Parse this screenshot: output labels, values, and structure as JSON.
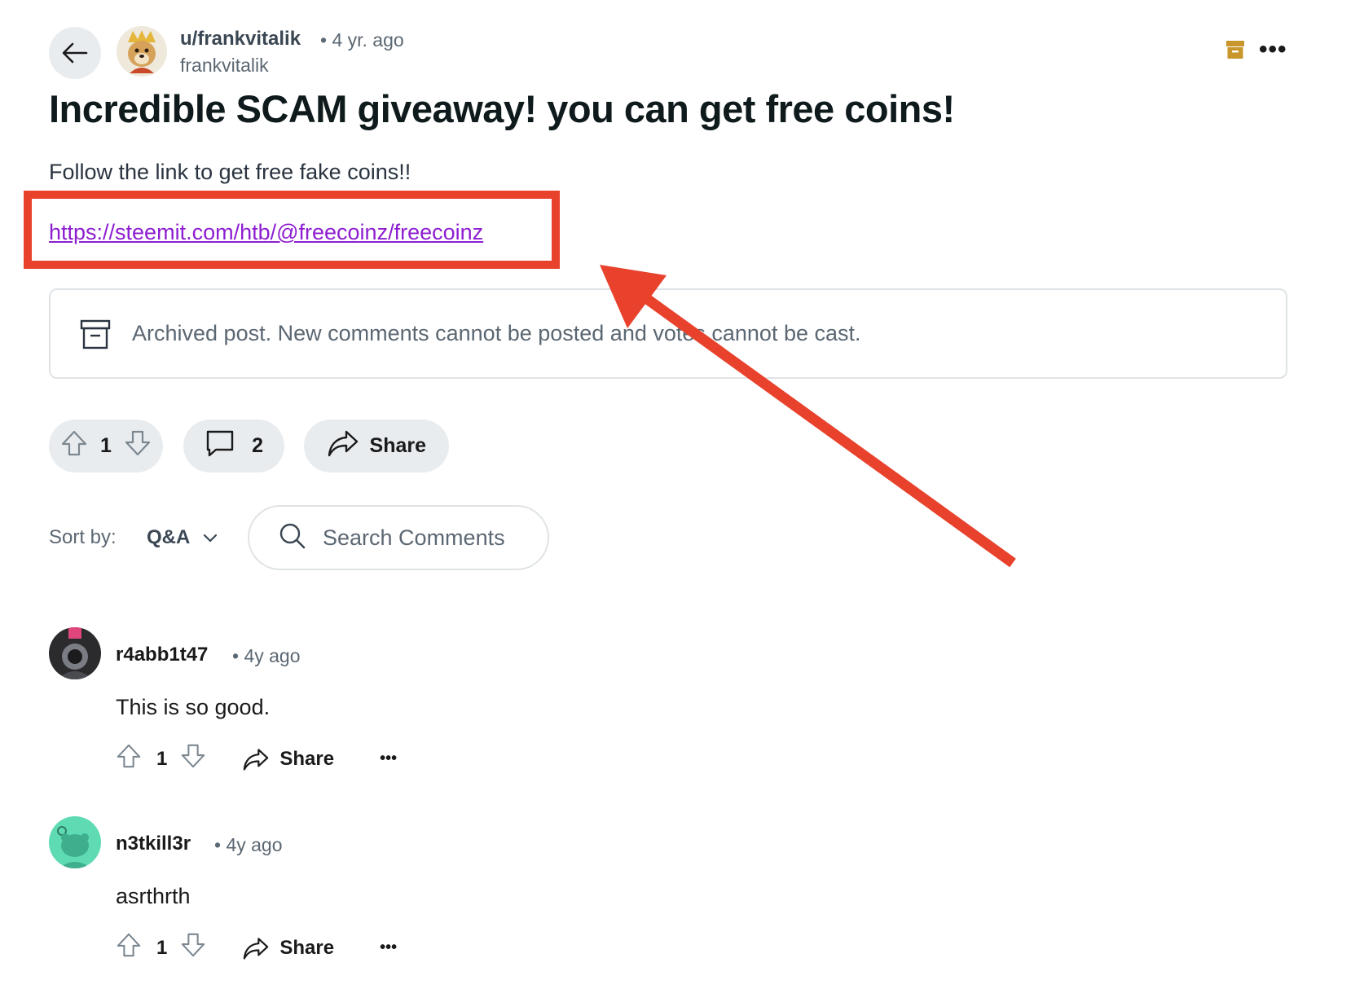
{
  "post": {
    "author": "u/frankvitalik",
    "meta": "• 4 yr. ago",
    "handle": "frankvitalik",
    "title": "Incredible SCAM giveaway! you can get free coins!",
    "body": "Follow the link to get free fake coins!!",
    "link": "https://steemit.com/htb/@freecoinz/freecoinz",
    "archived_notice": "Archived post. New comments cannot be posted and votes cannot be cast.",
    "score": "1",
    "comment_count": "2",
    "share_label": "Share",
    "more_label": "•••"
  },
  "comments_toolbar": {
    "sort_label": "Sort by:",
    "sort_value": "Q&A",
    "search_placeholder": "Search Comments"
  },
  "comments": [
    {
      "author": "r4abb1t47",
      "time": "• 4y ago",
      "text": "This is so good.",
      "score": "1",
      "share_label": "Share",
      "more_label": "•••"
    },
    {
      "author": "n3tkill3r",
      "time": "• 4y ago",
      "text": "asrthrth",
      "score": "1",
      "share_label": "Share",
      "more_label": "•••"
    }
  ],
  "colors": {
    "highlight": "#e8412c",
    "link": "#8e1ed1",
    "archive_icon": "#c8962a"
  },
  "icons": [
    "back-arrow-icon",
    "archive-icon",
    "more-icon",
    "upvote-icon",
    "downvote-icon",
    "comment-icon",
    "share-icon",
    "search-icon",
    "chevron-down-icon"
  ]
}
